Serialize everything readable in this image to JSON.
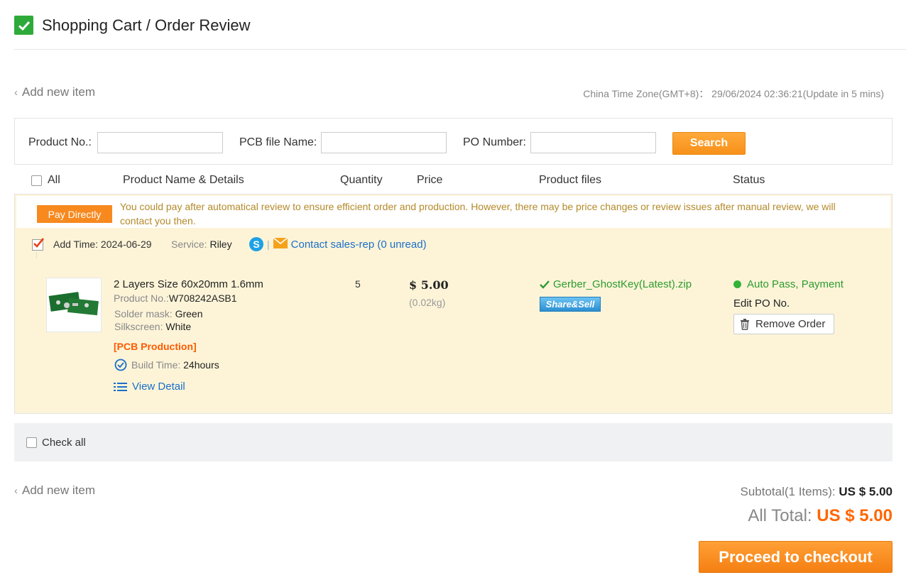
{
  "header": {
    "title": "Shopping Cart / Order Review"
  },
  "add_new_item": "Add new item",
  "timezone": "China Time Zone(GMT+8)： 29/06/2024 02:36:21(Update in 5 mins)",
  "search": {
    "product_no_label": "Product No.:",
    "pcb_file_label": "PCB file Name:",
    "po_number_label": "PO Number:",
    "product_no_value": "",
    "pcb_file_value": "",
    "po_number_value": "",
    "button": "Search"
  },
  "columns": {
    "all": "All",
    "product": "Product Name & Details",
    "quantity": "Quantity",
    "price": "Price",
    "files": "Product files",
    "status": "Status"
  },
  "order": {
    "pay_tag": "Pay Directly",
    "notice": "You could pay after automatical review to ensure efficient order and production. However, there may be price changes or review issues after manual review, we will contact you then.",
    "add_time_label": "Add Time:",
    "add_time": "2024-06-29",
    "service_label": "Service:",
    "service_name": "Riley",
    "contact": "Contact sales-rep (0 unread)",
    "separator": "|",
    "item": {
      "title": "2 Layers Size 60x20mm 1.6mm",
      "product_no_label": "Product No.:",
      "product_no": "W708242ASB1",
      "solder_label": "Solder mask:",
      "solder": "Green",
      "silk_label": "Silkscreen:",
      "silk": "White",
      "tag": "[PCB Production]",
      "build_label": "Build Time:",
      "build_time": "24hours",
      "view_detail": "View Detail",
      "quantity": "5",
      "price": "$ 5.00",
      "weight": "(0.02kg)",
      "file": "Gerber_GhostKey(Latest).zip",
      "share": "Share&Sell",
      "status": "Auto Pass, Payment",
      "edit_po": "Edit PO No.",
      "remove": "Remove Order"
    }
  },
  "check_all": "Check all",
  "totals": {
    "subtotal_label": "Subtotal(1 Items):",
    "subtotal": "US $ 5.00",
    "all_total_label": "All Total:",
    "all_total": "US $ 5.00"
  },
  "checkout_button": "Proceed to checkout",
  "colors": {
    "accent": "#f7891e",
    "success": "#2d9b2f",
    "link": "#1a6fc9",
    "total": "#ff6600"
  }
}
